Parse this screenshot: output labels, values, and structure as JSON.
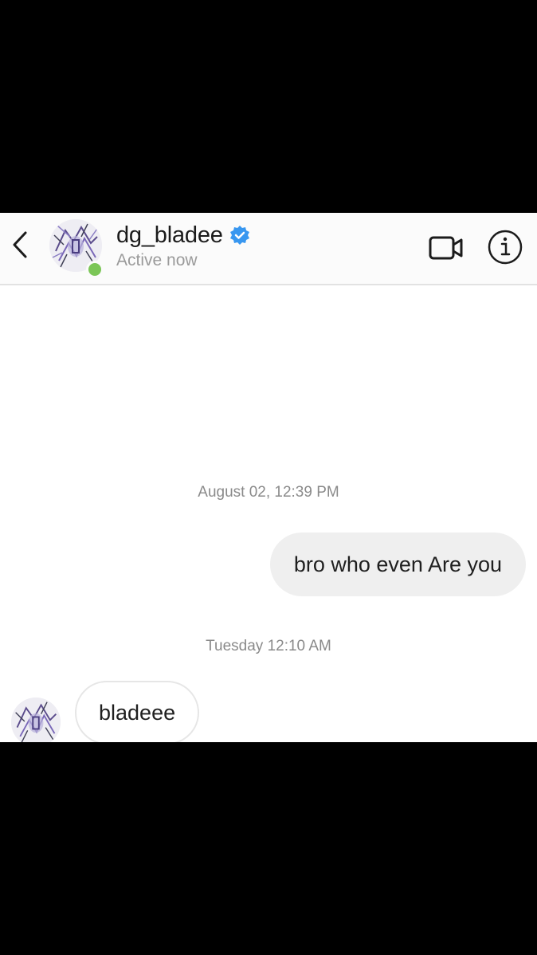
{
  "header": {
    "back_icon": "chevron-left-icon",
    "username": "dg_bladee",
    "verified_icon": "verified-badge-icon",
    "status": "Active now",
    "video_icon": "video-camera-icon",
    "info_icon": "info-icon"
  },
  "colors": {
    "verified": "#3897f0",
    "online": "#7bc657",
    "bubble_out": "#efefef",
    "timestamp": "#8a8a8a"
  },
  "messages": {
    "timestamp_1": "August 02, 12:39 PM",
    "outgoing_1": "bro who even Are you",
    "timestamp_2": "Tuesday 12:10 AM",
    "incoming_1": "bladeee"
  }
}
